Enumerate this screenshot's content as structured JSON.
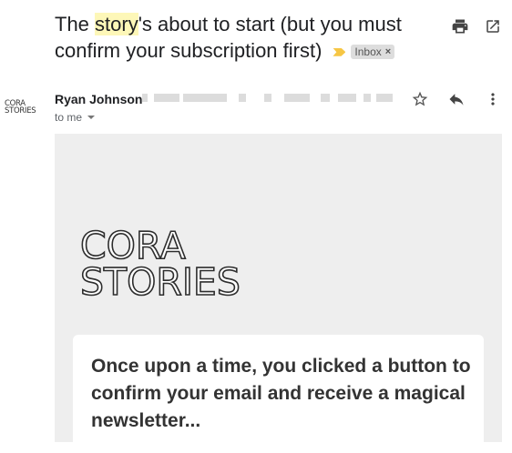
{
  "subject": {
    "before": "The ",
    "highlight": "story",
    "after": "'s about to start (but you must confirm your subscription first)",
    "label": "Inbox",
    "label_close": "×"
  },
  "header_icons": [
    "print-icon",
    "open-in-new-window-icon"
  ],
  "sender": {
    "name": "Ryan Johnson",
    "recipient": "to me",
    "avatar_logo": [
      "CORA",
      "STORIES"
    ]
  },
  "message_icons": [
    "star-icon",
    "reply-icon",
    "more-vertical-icon"
  ],
  "email": {
    "logo": [
      "CORA",
      "STORIES"
    ],
    "intro": "Once upon a time, you clicked a button to confirm your email and receive a magical newsletter..."
  },
  "colors": {
    "highlight": "#fdf7b8",
    "importance_marker": "#f6c644",
    "label_bg": "#dddddd",
    "body_bg": "#eeeeee"
  }
}
